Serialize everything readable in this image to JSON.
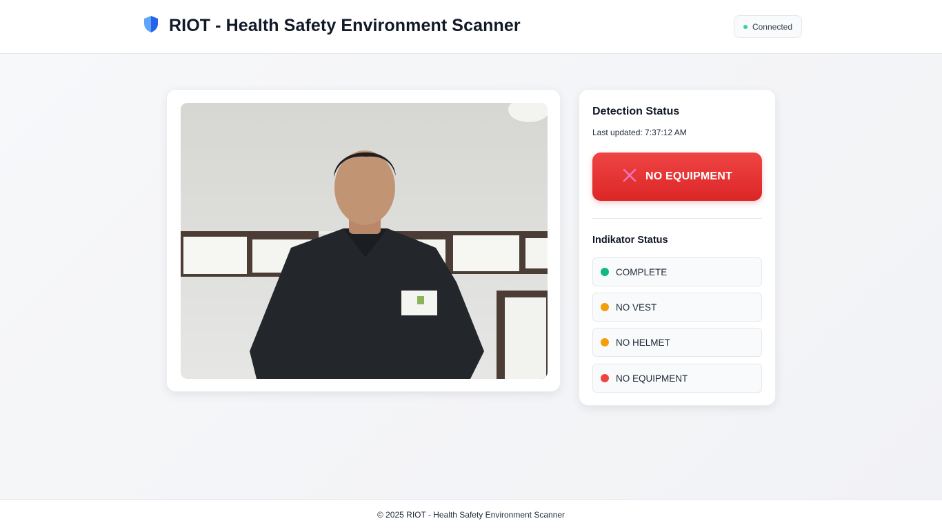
{
  "header": {
    "title": "RIOT - Health Safety Environment Scanner",
    "logo_icon": "shield-icon",
    "connection": {
      "label": "Connected",
      "color": "#34d399"
    }
  },
  "detection": {
    "title": "Detection Status",
    "last_updated": "Last updated: 7:37:12 AM",
    "alert": {
      "label": "NO EQUIPMENT",
      "icon": "x-icon",
      "color": "#ef4444"
    }
  },
  "indicator": {
    "title": "Indikator Status",
    "items": [
      {
        "label": "COMPLETE",
        "color": "#10b981"
      },
      {
        "label": "NO VEST",
        "color": "#f59e0b"
      },
      {
        "label": "NO HELMET",
        "color": "#f59e0b"
      },
      {
        "label": "NO EQUIPMENT",
        "color": "#ef4444"
      }
    ]
  },
  "footer": {
    "text": "© 2025 RIOT - Health Safety Environment Scanner"
  }
}
